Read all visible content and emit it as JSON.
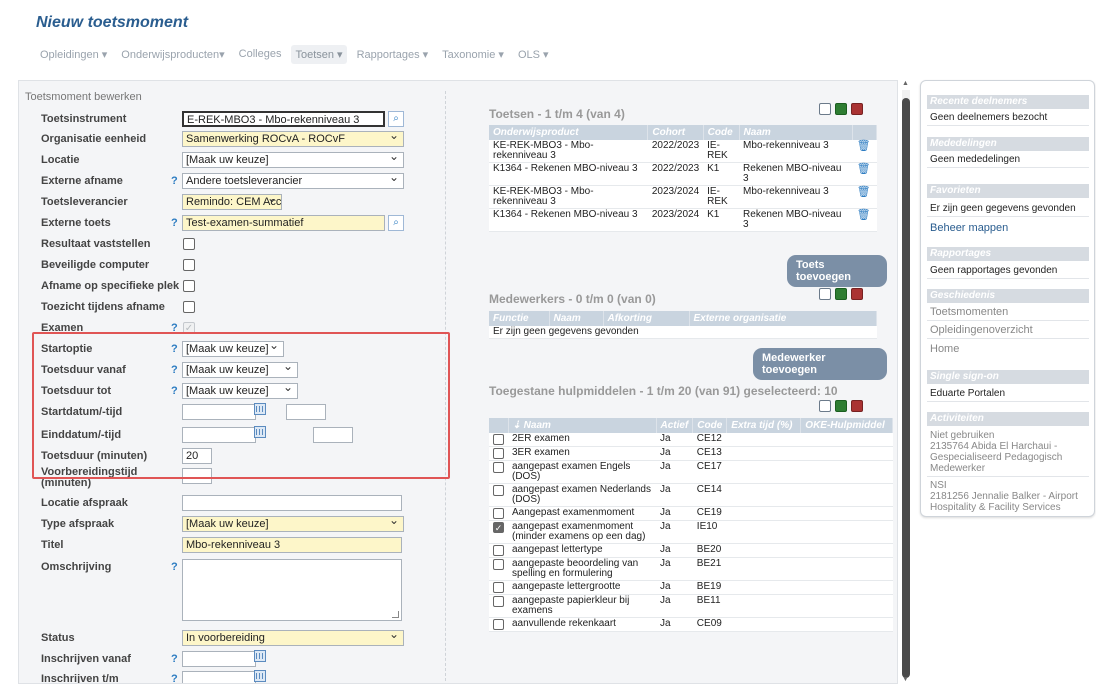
{
  "page": {
    "title": "Nieuw toetsmoment"
  },
  "nav": [
    {
      "label": "Opleidingen ▾"
    },
    {
      "label": "Onderwijsproducten▾"
    },
    {
      "label": "Colleges"
    },
    {
      "label": "Toetsen ▾"
    },
    {
      "label": "Rapportages ▾"
    },
    {
      "label": "Taxonomie ▾"
    },
    {
      "label": "OLS ▾"
    }
  ],
  "form": {
    "section": "Toetsmoment bewerken",
    "toetsinstrument": {
      "label": "Toetsinstrument",
      "value": "E-REK-MBO3 - Mbo-rekenniveau 3"
    },
    "organisatie": {
      "label": "Organisatie eenheid",
      "value": "Samenwerking ROCvA - ROCvF"
    },
    "locatie": {
      "label": "Locatie",
      "value": "[Maak uw keuze]"
    },
    "externe_afname": {
      "label": "Externe afname",
      "help": "?",
      "value": "Andere toetsleverancier"
    },
    "toetsleverancier": {
      "label": "Toetsleverancier",
      "value": "Remindo: CEM Acc"
    },
    "externe_toets": {
      "label": "Externe toets",
      "help": "?",
      "value": "Test-examen-summatief"
    },
    "resultaat": {
      "label": "Resultaat vaststellen"
    },
    "beveiligde": {
      "label": "Beveiligde computer"
    },
    "afname_plek": {
      "label": "Afname op specifieke plek"
    },
    "toezicht": {
      "label": "Toezicht tijdens afname"
    },
    "examen": {
      "label": "Examen",
      "help": "?",
      "mark": "✓"
    },
    "startoptie": {
      "label": "Startoptie",
      "help": "?",
      "value": "[Maak uw keuze]"
    },
    "duur_vanaf": {
      "label": "Toetsduur vanaf",
      "help": "?",
      "value": "[Maak uw keuze]"
    },
    "duur_tot": {
      "label": "Toetsduur tot",
      "help": "?",
      "value": "[Maak uw keuze]"
    },
    "startdatum": {
      "label": "Startdatum/-tijd"
    },
    "einddatum": {
      "label": "Einddatum/-tijd"
    },
    "toetsduur": {
      "label": "Toetsduur (minuten)",
      "value": "20"
    },
    "voorbereiding": {
      "label": "Voorbereidingstijd (minuten)"
    },
    "locatie_afspraak": {
      "label": "Locatie afspraak"
    },
    "type_afspraak": {
      "label": "Type afspraak",
      "value": "[Maak uw keuze]"
    },
    "titel": {
      "label": "Titel",
      "value": "Mbo-rekenniveau 3"
    },
    "omschrijving": {
      "label": "Omschrijving",
      "help": "?"
    },
    "status": {
      "label": "Status",
      "value": "In voorbereiding"
    },
    "inschr_vanaf": {
      "label": "Inschrijven vanaf",
      "help": "?"
    },
    "inschr_tm": {
      "label": "Inschrijven t/m",
      "help": "?"
    }
  },
  "toetsen": {
    "title": "Toetsen - 1 t/m 4 (van 4)",
    "headers": [
      "Onderwijsproduct",
      "Cohort",
      "Code",
      "Naam",
      ""
    ],
    "rows": [
      {
        "product": "KE-REK-MBO3 - Mbo-rekenniveau 3",
        "cohort": "2022/2023",
        "code": "IE-REK",
        "naam": "Mbo-rekenniveau 3"
      },
      {
        "product": "K1364 - Rekenen MBO-niveau 3",
        "cohort": "2022/2023",
        "code": "K1",
        "naam": "Rekenen MBO-niveau 3"
      },
      {
        "product": "KE-REK-MBO3 - Mbo-rekenniveau 3",
        "cohort": "2023/2024",
        "code": "IE-REK",
        "naam": "Mbo-rekenniveau 3"
      },
      {
        "product": "K1364 - Rekenen MBO-niveau 3",
        "cohort": "2023/2024",
        "code": "K1",
        "naam": "Rekenen MBO-niveau 3"
      }
    ],
    "add_button": "Toets toevoegen"
  },
  "medewerkers": {
    "title": "Medewerkers - 0 t/m 0 (van 0)",
    "headers": [
      "Functie",
      "Naam",
      "Afkorting",
      "Externe organisatie"
    ],
    "empty": "Er zijn geen gegevens gevonden",
    "add_button": "Medewerker toevoegen"
  },
  "hulpmiddelen": {
    "title": "Toegestane hulpmiddelen - 1 t/m 20 (van 91) geselecteerd: 10",
    "headers": [
      "",
      "⇣ Naam",
      "Actief",
      "Code",
      "Extra tijd (%)",
      "OKE-Hulpmiddel"
    ],
    "rows": [
      {
        "checked": false,
        "naam": "2ER examen",
        "actief": "Ja",
        "code": "CE12"
      },
      {
        "checked": false,
        "naam": "3ER examen",
        "actief": "Ja",
        "code": "CE13"
      },
      {
        "checked": false,
        "naam": "aangepast examen Engels (DOS)",
        "actief": "Ja",
        "code": "CE17"
      },
      {
        "checked": false,
        "naam": "aangepast examen Nederlands (DOS)",
        "actief": "Ja",
        "code": "CE14"
      },
      {
        "checked": false,
        "naam": "Aangepast examenmoment",
        "actief": "Ja",
        "code": "CE19"
      },
      {
        "checked": true,
        "naam": "aangepast examenmoment (minder examens op een dag)",
        "actief": "Ja",
        "code": "IE10"
      },
      {
        "checked": false,
        "naam": "aangepast lettertype",
        "actief": "Ja",
        "code": "BE20"
      },
      {
        "checked": false,
        "naam": "aangepaste beoordeling van spelling en formulering",
        "actief": "Ja",
        "code": "BE21"
      },
      {
        "checked": false,
        "naam": "aangepaste lettergrootte",
        "actief": "Ja",
        "code": "BE19"
      },
      {
        "checked": false,
        "naam": "aangepaste papierkleur bij examens",
        "actief": "Ja",
        "code": "BE11"
      },
      {
        "checked": false,
        "naam": "aanvullende rekenkaart",
        "actief": "Ja",
        "code": "CE09"
      }
    ]
  },
  "sidebar": {
    "recente": {
      "head": "Recente deelnemers",
      "text": "Geen deelnemers bezocht"
    },
    "mededelingen": {
      "head": "Mededelingen",
      "text": "Geen mededelingen"
    },
    "favorieten": {
      "head": "Favorieten",
      "text": "Er zijn geen gegevens gevonden",
      "link": "Beheer mappen"
    },
    "rapportages": {
      "head": "Rapportages",
      "text": "Geen rapportages gevonden"
    },
    "geschiedenis": {
      "head": "Geschiedenis",
      "items": [
        "Toetsmomenten",
        "Opleidingenoverzicht",
        "Home"
      ]
    },
    "sso": {
      "head": "Single sign-on",
      "text": "Eduarte Portalen"
    },
    "activiteiten": {
      "head": "Activiteiten",
      "a1": "Niet gebruiken",
      "a1_detail": "2135764 Abida El Harchaui - Gespecialiseerd Pedagogisch Medewerker",
      "a2": "NSI",
      "a2_detail": "2181256 Jennalie Balker - Airport Hospitality & Facility Services"
    }
  }
}
